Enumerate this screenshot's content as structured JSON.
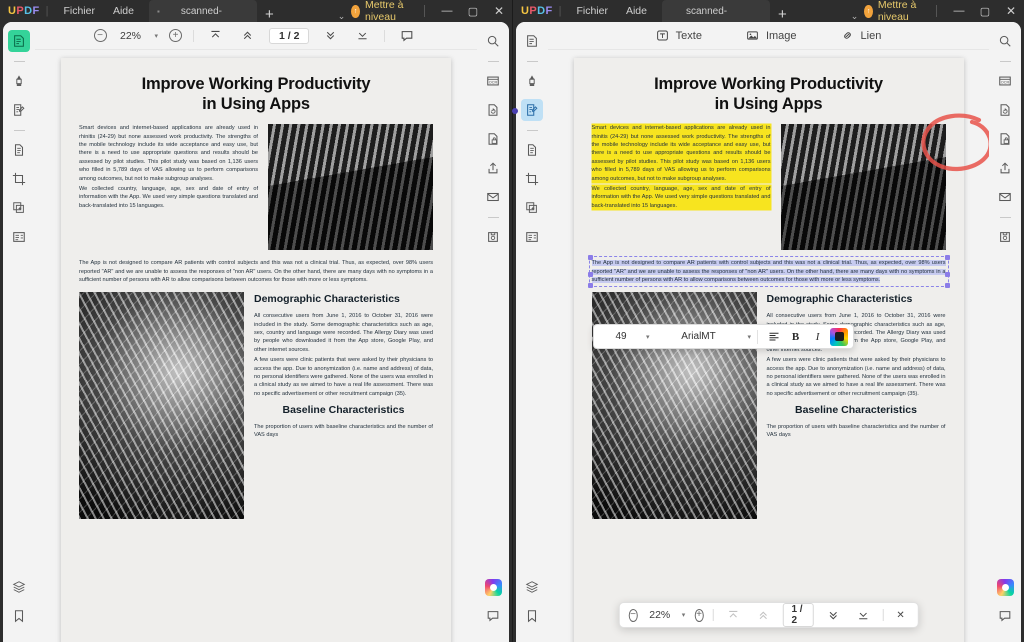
{
  "app": {
    "brand": "UPDF",
    "menus": [
      "Fichier",
      "Aide"
    ],
    "tab_title": "scanned-",
    "new_tab_label": "+",
    "tabs_chevron": "⌄",
    "upgrade_label": "Mettre à niveau",
    "upgrade_badge": "↑",
    "window": {
      "minimize": "—",
      "maximize": "▢",
      "close": "✕"
    }
  },
  "left_pane": {
    "toolbar": {
      "zoom_out": "−",
      "zoom_value": "22%",
      "zoom_caret": "▾",
      "zoom_in": "+",
      "first_page": "first-page",
      "prev_page": "prev-page",
      "page_indicator": "1 / 2",
      "next_page": "next-page",
      "last_page": "last-page",
      "comment": "comment"
    },
    "left_rail": [
      {
        "name": "reader-view",
        "active": true
      },
      {
        "name": "annotate-highlighter",
        "active": false
      },
      {
        "name": "edit-pdf",
        "active": false
      },
      {
        "name": "organize-pages",
        "active": false
      },
      {
        "name": "crop-pages",
        "active": false
      },
      {
        "name": "batch-process",
        "active": false
      },
      {
        "name": "forms",
        "active": false
      }
    ],
    "right_rail": [
      "search",
      "ocr",
      "convert",
      "protect",
      "share",
      "email",
      "save-as"
    ],
    "bottom_rail": [
      "layers",
      "bookmark"
    ],
    "bottom_right_rail": [
      "ai-assistant",
      "comment"
    ]
  },
  "right_pane": {
    "edit_toolbar": [
      {
        "label": "Texte",
        "icon": "text-icon"
      },
      {
        "label": "Image",
        "icon": "image-icon"
      },
      {
        "label": "Lien",
        "icon": "link-icon"
      }
    ],
    "format_toolbar": {
      "font_size": "49",
      "font_size_caret": "▾",
      "font_family": "ArialMT",
      "font_family_caret": "▾",
      "align": "align-left",
      "bold": "B",
      "italic": "I",
      "color": "color-picker"
    },
    "bottom_toolbar": {
      "zoom_out": "−",
      "zoom_value": "22%",
      "zoom_caret": "▾",
      "zoom_in": "+",
      "first_page": "first-page",
      "prev_page": "prev-page",
      "page_indicator": "1 / 2",
      "next_page": "next-page",
      "last_page": "last-page",
      "close": "✕"
    },
    "left_rail_active": "edit-pdf",
    "annotations": {
      "highlight_color": "#f7e41f",
      "ink_circle_color": "#e8524a",
      "selection_border_color": "#8b84e8",
      "selection_fill_color": "#c7cbf0"
    }
  },
  "document": {
    "title_line1": "Improve Working Productivity",
    "title_line2": "in Using Apps",
    "para1": "Smart devices and internet-based applications are already used in rhinitis (24-29) but none assessed work productivity. The strengths of the mobile technology include its wide acceptance and easy use, but there is a need to use appropriate questions and results should be assessed by pilot studies. This pilot study was based on 1,136 users who filled in 5,789 days of VAS allowing us to perform comparisons among outcomes, but not to make subgroup analyses.",
    "para2": "We collected country, language, age, sex and date of entry of information with the App. We used very simple questions translated and back-translated into 15 languages.",
    "para3": "The App is not designed to compare AR patients with control subjects and this was not a clinical trial. Thus, as expected, over 98% users reported \"AR\" and we are unable to assess the responses of \"non AR\" users. On the other hand, there are many days with no symptoms in a sufficient number of persons with AR to allow comparisons between outcomes for those with more or less symptoms.",
    "heading1": "Demographic Characteristics",
    "para4": "All consecutive users from June 1, 2016 to October 31, 2016 were included in the study. Some demographic characteristics such as age, sex, country and language were recorded. The Allergy Diary was used by people who downloaded it from the App store, Google Play, and other internet sources.",
    "para5": "A few users were clinic patients that were asked by their physicians to access the app. Due to anonymization (i.e. name and address) of data, no personal identifiers were gathered. None of the users was enrolled in a clinical study as we aimed to have a real life assessment. There was no specific advertisement or other recruitment campaign (35).",
    "heading2": "Baseline Characteristics",
    "para6": "The proportion of users with baseline characteristics and the number of VAS days"
  }
}
